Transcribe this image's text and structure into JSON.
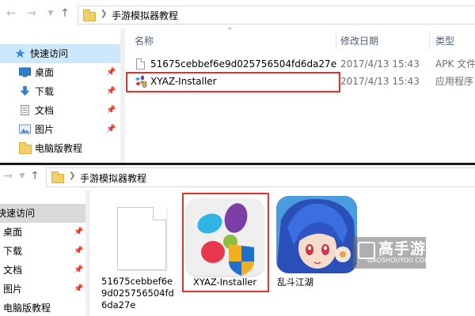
{
  "top_window": {
    "breadcrumb": [
      "手游模拟器教程"
    ],
    "nav_items": [
      {
        "label": "快速访问",
        "icon": "star-icon",
        "selected": true,
        "pinned": false
      },
      {
        "label": "桌面",
        "icon": "desktop-icon",
        "selected": false,
        "pinned": true
      },
      {
        "label": "下载",
        "icon": "download-icon",
        "selected": false,
        "pinned": true
      },
      {
        "label": "文档",
        "icon": "document-icon",
        "selected": false,
        "pinned": true
      },
      {
        "label": "图片",
        "icon": "picture-icon",
        "selected": false,
        "pinned": true
      },
      {
        "label": "电脑版教程",
        "icon": "folder-icon",
        "selected": false,
        "pinned": false
      }
    ],
    "columns": {
      "name": "名称",
      "date": "修改日期",
      "type": "类型"
    },
    "files": [
      {
        "name": "51675cebbef6e9d025756504fd6da27e",
        "date": "2017/4/13 15:43",
        "type": "APK 文件",
        "icon": "blank-file-icon"
      },
      {
        "name": "XYAZ-Installer",
        "date": "2017/4/13 15:43",
        "type": "应用程序",
        "icon": "xyaz-app-icon"
      }
    ]
  },
  "bottom_window": {
    "breadcrumb": [
      "手游模拟器教程"
    ],
    "nav_items": [
      {
        "label": "快速访问",
        "selected": true,
        "pinned": false
      },
      {
        "label": "桌面",
        "selected": false,
        "pinned": true
      },
      {
        "label": "下载",
        "selected": false,
        "pinned": true
      },
      {
        "label": "文档",
        "selected": false,
        "pinned": true
      },
      {
        "label": "图片",
        "selected": false,
        "pinned": true
      },
      {
        "label": "电脑版教程",
        "selected": false,
        "pinned": false
      }
    ],
    "tiles": [
      {
        "name_lines": [
          "51675cebbef6e",
          "9d025756504fd",
          "6da27e"
        ],
        "icon": "blank-file-icon"
      },
      {
        "name_lines": [
          "XYAZ-Installer"
        ],
        "icon": "xyaz-app-icon"
      },
      {
        "name_lines": [
          "乱斗江湖"
        ],
        "icon": "game-app-icon"
      }
    ]
  },
  "watermark": {
    "title": "高手游",
    "subtitle": "GAOSHOUYOU.COM"
  },
  "colors": {
    "selection": "#cce8ff",
    "highlight_box": "#e8302a",
    "folder": "#f3cf6a",
    "column_header": "#4c607a"
  }
}
